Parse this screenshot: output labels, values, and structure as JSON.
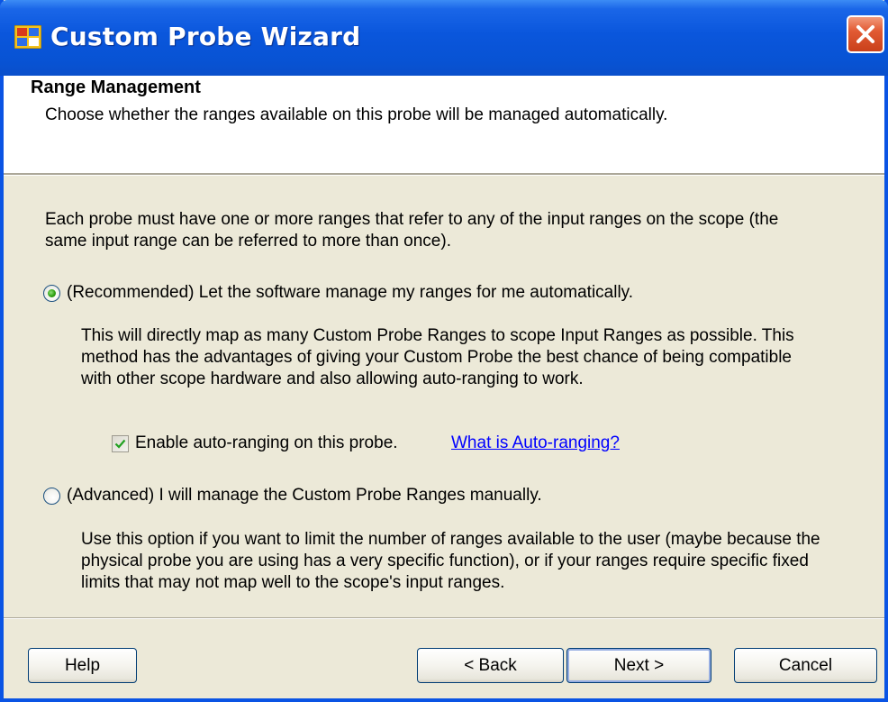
{
  "window": {
    "title": "Custom Probe Wizard",
    "accent_color": "#0a54e4",
    "close_icon": "close-icon"
  },
  "header": {
    "heading": "Range Management",
    "description": "Choose whether the ranges available on this probe will be managed automatically."
  },
  "body": {
    "intro": "Each probe must have one or more ranges that refer to any of the input ranges on the scope (the same input range can be referred to more than once).",
    "option_recommended": {
      "label": "(Recommended) Let the software manage my ranges for me automatically.",
      "selected": true,
      "description": "This will directly map as many Custom Probe Ranges to scope Input Ranges as possible. This method has the advantages of giving your Custom Probe the best chance of being compatible with other scope hardware and also allowing auto-ranging to work.",
      "checkbox_label": "Enable auto-ranging on this probe.",
      "checkbox_checked": true,
      "link_text": "What is Auto-ranging?"
    },
    "option_advanced": {
      "label": "(Advanced) I will manage the Custom Probe Ranges manually.",
      "selected": false,
      "description": "Use this option if you want to limit the number of ranges available to the user (maybe because the physical probe you are using has a very specific function), or if your ranges require specific fixed limits that may not map well to the scope's input ranges."
    }
  },
  "buttons": {
    "help": "Help",
    "back": "< Back",
    "next": "Next >",
    "cancel": "Cancel"
  }
}
